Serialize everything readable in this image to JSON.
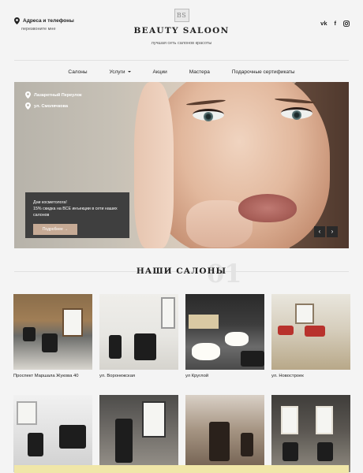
{
  "header": {
    "contacts_title": "Адреса и телефоны",
    "contacts_sub": "перезвоните мне",
    "logo_mark": "BS",
    "brand": "BEAUTY SALOON",
    "tagline": "лучшая сеть салонов красоты",
    "social": [
      "vk",
      "f",
      "instagram"
    ]
  },
  "nav": {
    "items": [
      "Салоны",
      "Услуги",
      "Акции",
      "Мастера",
      "Подарочные сертификаты"
    ]
  },
  "hero": {
    "addresses": [
      "Лазаретный Переулок",
      "ул. Смолячкова"
    ],
    "promo_line1": "Дни косметолога!",
    "promo_line2": "15% скидка на ВСЕ инъекции в сети наших салонов",
    "promo_button": "Подробнее →",
    "arrow_prev": "‹",
    "arrow_next": "›"
  },
  "salons": {
    "title": "НАШИ САЛОНЫ",
    "number": "01",
    "items": [
      {
        "caption": "Проспект Маршала Жукова 40"
      },
      {
        "caption": "ул. Воронежская"
      },
      {
        "caption": "ул Круглой"
      },
      {
        "caption": "ул. Новостроек"
      },
      {
        "caption": ""
      },
      {
        "caption": ""
      },
      {
        "caption": ""
      },
      {
        "caption": ""
      }
    ]
  },
  "colors": {
    "accent": "#c6aa95",
    "promo_bg": "#3f3f3f",
    "page_bg": "#f4f4f4"
  }
}
